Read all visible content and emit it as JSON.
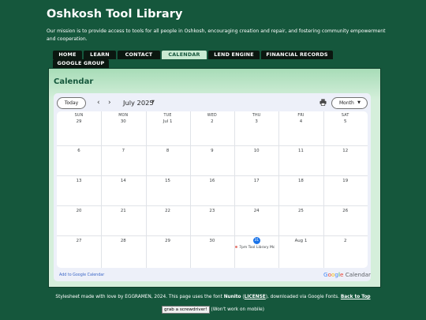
{
  "site": {
    "title": "Oshkosh Tool Library",
    "mission": "Our mission is to provide access to tools for all people in Oshkosh, encouraging creation and repair, and fostering community empowerment and cooperation."
  },
  "nav": {
    "items": [
      "HOME",
      "LEARN",
      "CONTACT",
      "CALENDAR",
      "LEND ENGINE",
      "FINANCIAL RECORDS",
      "GOOGLE GROUP"
    ],
    "active": "CALENDAR"
  },
  "calendar": {
    "heading": "Calendar",
    "today_label": "Today",
    "prev_icon": "chevron-left-icon",
    "next_icon": "chevron-right-icon",
    "month_label": "July 2025",
    "print_icon": "printer-icon",
    "view_label": "Month",
    "weekdays": [
      "SUN",
      "MON",
      "TUE",
      "WED",
      "THU",
      "FRI",
      "SAT"
    ],
    "weeks": [
      [
        "29",
        "30",
        "Jul 1",
        "2",
        "3",
        "4",
        "5"
      ],
      [
        "6",
        "7",
        "8",
        "9",
        "10",
        "11",
        "12"
      ],
      [
        "13",
        "14",
        "15",
        "16",
        "17",
        "18",
        "19"
      ],
      [
        "20",
        "21",
        "22",
        "23",
        "24",
        "25",
        "26"
      ],
      [
        "27",
        "28",
        "29",
        "30",
        "31",
        "Aug 1",
        "2"
      ]
    ],
    "today": "31",
    "event": "7pm Tool Library Mc",
    "add_link": "Add to Google Calendar",
    "logo_google": "Google",
    "logo_calendar": "Calendar",
    "colors": {
      "today": "#1a73e8",
      "event_dot": "#e67c73"
    }
  },
  "footer": {
    "credit_prefix": "Stylesheet made with love by EGGRAMEN, 2024. This page uses the font ",
    "font_name": "Nunito",
    "license_open": " (",
    "license_link": "LICENSE",
    "credit_suffix": "), downloaded via Google Fonts. ",
    "top_link": "Back to Top",
    "button_label": "grab a screwdriver!",
    "note": "(Won't work on mobile)"
  },
  "colors": {
    "background": "#15573c",
    "nav_tab": "#0b1710",
    "nav_active": "#c9ead2"
  }
}
